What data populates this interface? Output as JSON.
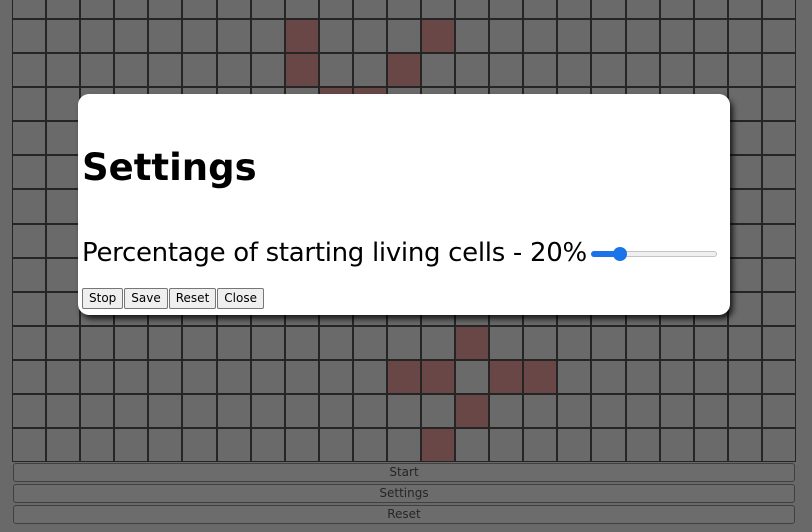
{
  "board": {
    "cols": 23,
    "rows": 14,
    "living_cells": [
      [
        8,
        1
      ],
      [
        12,
        1
      ],
      [
        8,
        2
      ],
      [
        11,
        2
      ],
      [
        9,
        3
      ],
      [
        10,
        3
      ],
      [
        13,
        10
      ],
      [
        11,
        11
      ],
      [
        12,
        11
      ],
      [
        14,
        11
      ],
      [
        15,
        11
      ],
      [
        13,
        12
      ],
      [
        12,
        13
      ]
    ]
  },
  "controls": {
    "start_label": "Start",
    "settings_label": "Settings",
    "reset_label": "Reset"
  },
  "settings_dialog": {
    "title": "Settings",
    "slider_label": "Percentage of starting living cells - 20%",
    "living_percentage": 20,
    "slider_min": 0,
    "slider_max": 100,
    "buttons": {
      "stop": "Stop",
      "save": "Save",
      "reset": "Reset",
      "close": "Close"
    }
  },
  "colors": {
    "background": "#696969",
    "dead_cell": "#6b6b6b",
    "alive_cell": "#6a3535",
    "accent": "#1a73e8"
  }
}
